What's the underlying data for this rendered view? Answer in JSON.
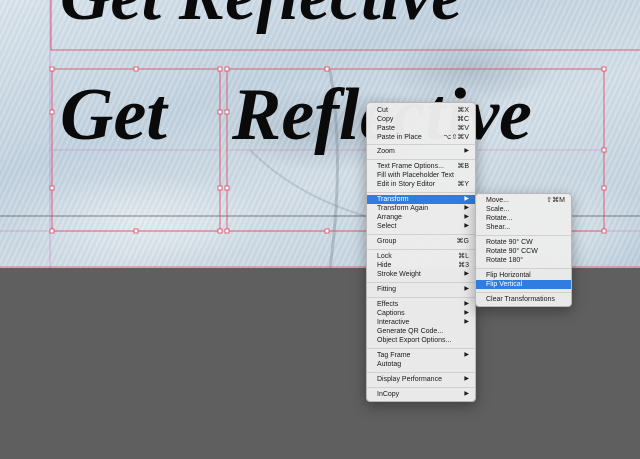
{
  "canvas": {
    "headline_top": "Get Reflective",
    "headline_left": "Get",
    "headline_right": "Reflective"
  },
  "context_menu": {
    "items": [
      {
        "label": "Cut",
        "shortcut": "⌘X"
      },
      {
        "label": "Copy",
        "shortcut": "⌘C"
      },
      {
        "label": "Paste",
        "shortcut": "⌘V"
      },
      {
        "label": "Paste in Place",
        "shortcut": "⌥⇧⌘V"
      },
      {
        "label": "Zoom",
        "submenu": true
      },
      {
        "label": "Text Frame Options...",
        "shortcut": "⌘B"
      },
      {
        "label": "Fill with Placeholder Text"
      },
      {
        "label": "Edit in Story Editor",
        "shortcut": "⌘Y"
      },
      {
        "label": "Transform",
        "submenu": true,
        "highlighted": true
      },
      {
        "label": "Transform Again",
        "submenu": true
      },
      {
        "label": "Arrange",
        "submenu": true
      },
      {
        "label": "Select",
        "submenu": true
      },
      {
        "label": "Group",
        "shortcut": "⌘G"
      },
      {
        "label": "Lock",
        "shortcut": "⌘L"
      },
      {
        "label": "Hide",
        "shortcut": "⌘3"
      },
      {
        "label": "Stroke Weight",
        "submenu": true
      },
      {
        "label": "Fitting",
        "submenu": true
      },
      {
        "label": "Effects",
        "submenu": true
      },
      {
        "label": "Captions",
        "submenu": true
      },
      {
        "label": "Interactive",
        "submenu": true
      },
      {
        "label": "Generate QR Code..."
      },
      {
        "label": "Object Export Options..."
      },
      {
        "label": "Tag Frame",
        "submenu": true
      },
      {
        "label": "Autotag"
      },
      {
        "label": "Display Performance",
        "submenu": true
      },
      {
        "label": "InCopy",
        "submenu": true
      }
    ]
  },
  "transform_submenu": {
    "items": [
      {
        "label": "Move...",
        "shortcut": "⇧⌘M"
      },
      {
        "label": "Scale..."
      },
      {
        "label": "Rotate..."
      },
      {
        "label": "Shear..."
      },
      {
        "label": "Rotate 90° CW"
      },
      {
        "label": "Rotate 90° CCW"
      },
      {
        "label": "Rotate 180°"
      },
      {
        "label": "Flip Horizontal"
      },
      {
        "label": "Flip Vertical",
        "highlighted": true
      },
      {
        "label": "Clear Transformations"
      }
    ]
  },
  "colors": {
    "highlight": "#2f7de1",
    "frame_stroke": "#e0445a",
    "guide": "#d04cc4",
    "pasteboard": "#5f5f5f"
  }
}
